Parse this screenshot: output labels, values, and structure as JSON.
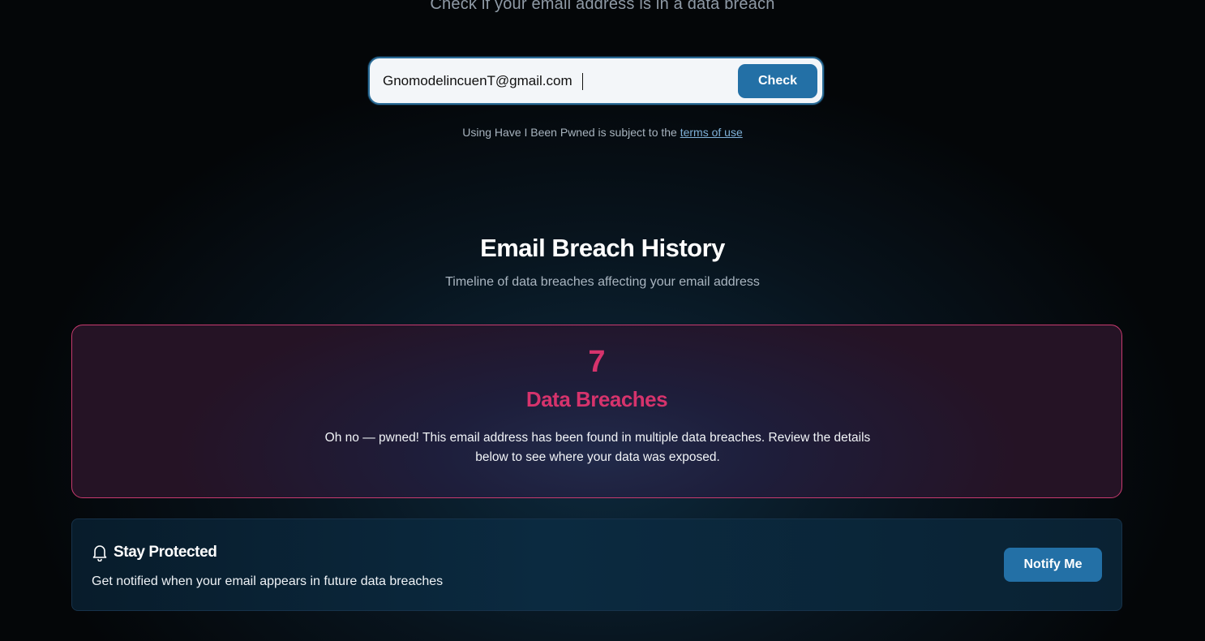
{
  "header": {
    "subtitle": "Check if your email address is in a data breach"
  },
  "search": {
    "value": "GnomodelincuenT@gmail.com",
    "button_label": "Check"
  },
  "terms": {
    "prefix": "Using Have I Been Pwned is subject to the",
    "link_label": "terms of use"
  },
  "history": {
    "title": "Email Breach History",
    "subtitle": "Timeline of data breaches affecting your email address"
  },
  "breach_summary": {
    "count": "7",
    "label": "Data Breaches",
    "description": "Oh no — pwned! This email address has been found in multiple data breaches. Review the details below to see where your data was exposed.",
    "accent_color": "#d6336c"
  },
  "protect": {
    "icon": "bell-icon",
    "title": "Stay Protected",
    "description": "Get notified when your email appears in future data breaches",
    "button_label": "Notify Me"
  },
  "colors": {
    "primary_button": "#2370a6",
    "background": "#040608"
  }
}
